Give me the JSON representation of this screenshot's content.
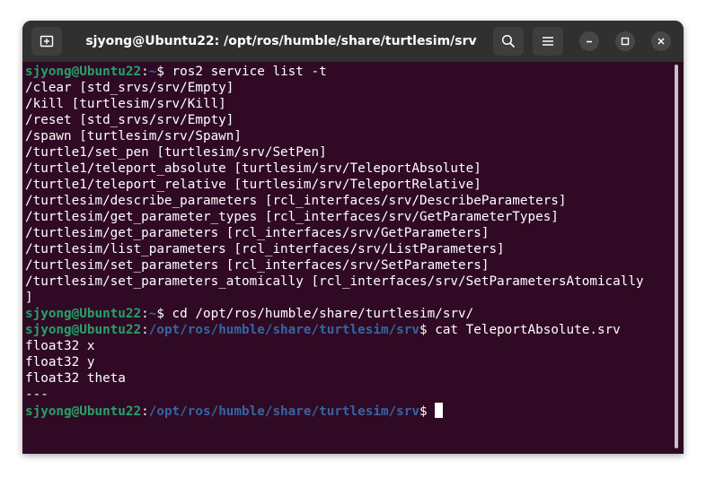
{
  "window": {
    "title": "sjyong@Ubuntu22: /opt/ros/humble/share/turtlesim/srv",
    "icons": [
      "new-tab-icon",
      "search-icon",
      "hamburger-menu-icon",
      "minimize-icon",
      "maximize-icon",
      "close-icon"
    ]
  },
  "terminal": {
    "prompt_user": "sjyong@Ubuntu22",
    "cmd1": {
      "colon": ":",
      "path": "~",
      "rest": "$ ros2 service list -t"
    },
    "output": [
      "/clear [std_srvs/srv/Empty]",
      "/kill [turtlesim/srv/Kill]",
      "/reset [std_srvs/srv/Empty]",
      "/spawn [turtlesim/srv/Spawn]",
      "/turtle1/set_pen [turtlesim/srv/SetPen]",
      "/turtle1/teleport_absolute [turtlesim/srv/TeleportAbsolute]",
      "/turtle1/teleport_relative [turtlesim/srv/TeleportRelative]",
      "/turtlesim/describe_parameters [rcl_interfaces/srv/DescribeParameters]",
      "/turtlesim/get_parameter_types [rcl_interfaces/srv/GetParameterTypes]",
      "/turtlesim/get_parameters [rcl_interfaces/srv/GetParameters]",
      "/turtlesim/list_parameters [rcl_interfaces/srv/ListParameters]",
      "/turtlesim/set_parameters [rcl_interfaces/srv/SetParameters]",
      "/turtlesim/set_parameters_atomically [rcl_interfaces/srv/SetParametersAtomically",
      "]"
    ],
    "cmd2": {
      "colon": ":",
      "path": "~",
      "rest": "$ cd /opt/ros/humble/share/turtlesim/srv/"
    },
    "cmd3": {
      "colon": ":",
      "path": "/opt/ros/humble/share/turtlesim/srv",
      "rest": "$ cat TeleportAbsolute.srv"
    },
    "srv_lines": [
      "float32 x",
      "float32 y",
      "float32 theta",
      "---"
    ],
    "cmd4": {
      "colon": ":",
      "path": "/opt/ros/humble/share/turtlesim/srv",
      "rest": "$ "
    }
  },
  "colors": {
    "background": "#300a24",
    "user": "#26a269",
    "path": "#3465a4",
    "text": "#ffffff"
  }
}
